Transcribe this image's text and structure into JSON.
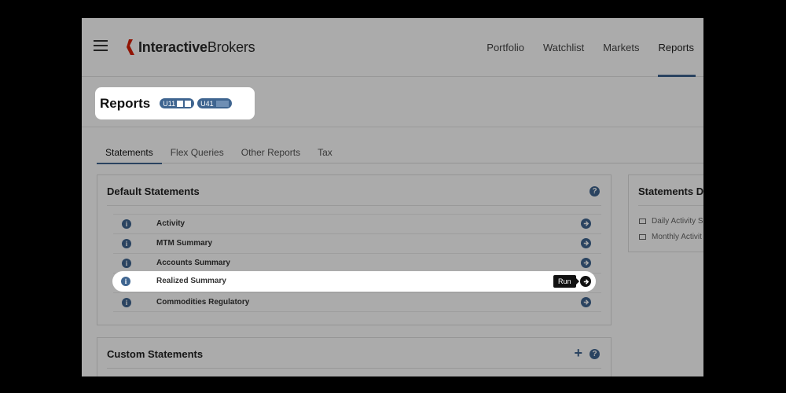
{
  "header": {
    "logo_bold": "Interactive",
    "logo_rest": "Brokers",
    "nav": [
      "Portfolio",
      "Watchlist",
      "Markets",
      "Reports"
    ],
    "active_nav": "Reports"
  },
  "title": {
    "text": "Reports",
    "accounts": [
      "U11",
      "U41"
    ]
  },
  "tabs": [
    "Statements",
    "Flex Queries",
    "Other Reports",
    "Tax"
  ],
  "active_tab": "Statements",
  "default_statements": {
    "title": "Default Statements",
    "items": [
      "Activity",
      "MTM Summary",
      "Accounts Summary",
      "Realized Summary",
      "Commodities Regulatory"
    ],
    "highlighted_item": "Realized Summary",
    "tooltip": "Run"
  },
  "custom_statements": {
    "title": "Custom Statements"
  },
  "statements_delivery": {
    "title": "Statements D",
    "items": [
      "Daily Activity S",
      "Monthly Activit"
    ]
  },
  "colors": {
    "accent": "#3f6590",
    "brand_red": "#d81e05"
  },
  "icons": {
    "menu": "hamburger-icon",
    "help": "question-icon",
    "info": "info-icon",
    "run": "arrow-right-circle-icon",
    "add": "plus-icon",
    "mail": "envelope-icon"
  }
}
